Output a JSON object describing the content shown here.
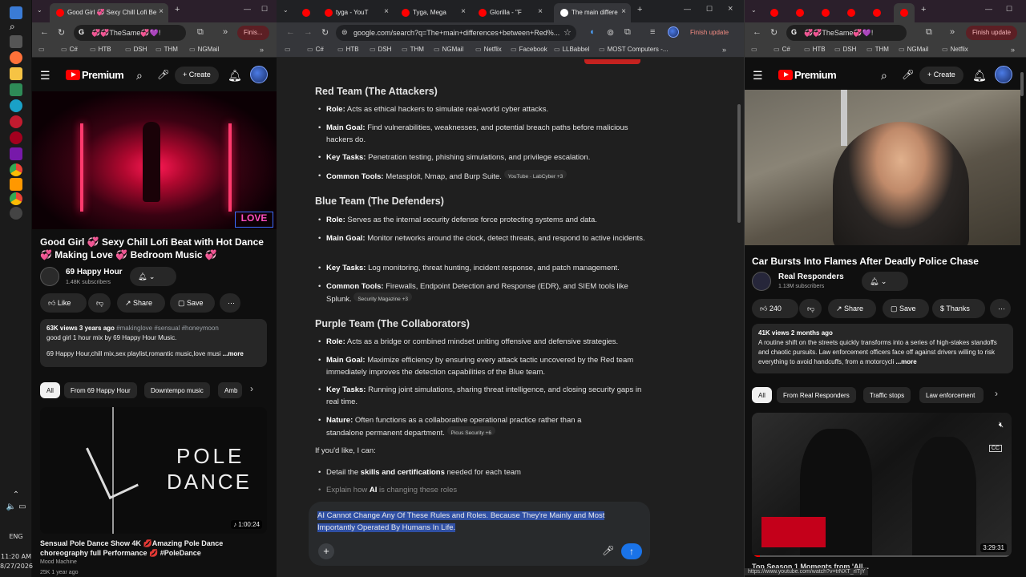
{
  "taskbar": {
    "time": "11:20 AM",
    "date": "8/27/2026",
    "lang": "ENG"
  },
  "left_window": {
    "tabs": [
      {
        "label": "Good Girl 💞 Sexy Chill Lofi Be"
      }
    ],
    "address": "💞💞TheSame💞💜!",
    "finish_label": "Finis...",
    "bookmarks": [
      "C#",
      "HTB",
      "DSH",
      "THM",
      "NGMail"
    ],
    "brand": "Premium",
    "create_label": "Create",
    "video_title": "Good Girl 💞 Sexy Chill Lofi Beat with Hot Dance 💞 Making Love 💞 Bedroom Music 💞",
    "channel_name": "69 Happy Hour",
    "subscribers": "1.48K subscribers",
    "actions": {
      "like": "Like",
      "share": "Share",
      "save": "Save"
    },
    "desc_stats": "63K views  3 years ago",
    "desc_tags": "#makinglove #sensual #honeymoon",
    "desc_line1": "good girl 1 hour mix by 69 Happy Hour Music.",
    "desc_line2": "69 Happy Hour,chill mix,sex playlist,romantic music,love musi",
    "desc_more": "...more",
    "chips": [
      "All",
      "From 69 Happy Hour",
      "Downtempo music",
      "Amb"
    ],
    "thumb_text_1": "POLE",
    "thumb_text_2": "DANCE",
    "thumb_duration": "1:00:24",
    "next_title": "Sensual Pole Dance Show 4K 💋Amazing Pole Dance choreography full Performance 💋 #PoleDance",
    "next_channel": "Mood Machine",
    "next_meta": "25K  1 year ago"
  },
  "middle_window": {
    "tabs": [
      {
        "label": ""
      },
      {
        "label": "tyga - YouT"
      },
      {
        "label": "Tyga, Mega"
      },
      {
        "label": "Glorilla - \"F"
      },
      {
        "label": "The main differe"
      }
    ],
    "url": "google.com/search?q=The+main+differences+between+Red%...",
    "finish_label": "Finish update",
    "bookmarks": [
      "C#",
      "HTB",
      "DSH",
      "THM",
      "NGMail",
      "Netflix",
      "Facebook",
      "LLBabbel",
      "MOST Computers -..."
    ],
    "sections": [
      {
        "heading": "Red Team (The Attackers)",
        "items": [
          {
            "label": "Role:",
            "text": "Acts as ethical hackers to simulate real-world cyber attacks.",
            "source": ""
          },
          {
            "label": "Main Goal:",
            "text": "Find vulnerabilities, weaknesses, and potential breach paths before malicious hackers do.",
            "source": ""
          },
          {
            "label": "Key Tasks:",
            "text": "Penetration testing, phishing simulations, and privilege escalation.",
            "source": ""
          },
          {
            "label": "Common Tools:",
            "text": "Metasploit, Nmap, and Burp Suite.",
            "source": "YouTube · LabCyber +3"
          }
        ]
      },
      {
        "heading": "Blue Team (The Defenders)",
        "items": [
          {
            "label": "Role:",
            "text": "Serves as the internal security defense force protecting systems and data.",
            "source": ""
          },
          {
            "label": "Main Goal:",
            "text": "Monitor networks around the clock, detect threats, and respond to active incidents.",
            "source": ""
          },
          {
            "label": "Key Tasks:",
            "text": "Log monitoring, threat hunting, incident response, and patch management.",
            "source": ""
          },
          {
            "label": "Common Tools:",
            "text": "Firewalls, Endpoint Detection and Response (EDR), and SIEM tools like Splunk.",
            "source": "Security Magazine +3"
          }
        ]
      },
      {
        "heading": "Purple Team (The Collaborators)",
        "items": [
          {
            "label": "Role:",
            "text": "Acts as a bridge or combined mindset uniting offensive and defensive strategies.",
            "source": ""
          },
          {
            "label": "Main Goal:",
            "text": "Maximize efficiency by ensuring every attack tactic uncovered by the Red team immediately improves the detection capabilities of the Blue team.",
            "source": ""
          },
          {
            "label": "Key Tasks:",
            "text": "Running joint simulations, sharing threat intelligence, and closing security gaps in real time.",
            "source": ""
          },
          {
            "label": "Nature:",
            "text": "Often functions as a collaborative operational practice rather than a standalone permanent department.",
            "source": "Picus Security +6"
          }
        ]
      }
    ],
    "followup_intro": "If you'd like, I can:",
    "followup_1_pre": "Detail the ",
    "followup_1_bold": "skills and certifications",
    "followup_1_post": " needed for each team",
    "followup_2_pre": "Explain how ",
    "followup_2_bold": "AI",
    "followup_2_post": " is changing these roles",
    "composer_text": "AI Cannot Change Any Of These Rules and Roles. Because They're Mainly and Most Importantly Operated By Humans In Life."
  },
  "right_window": {
    "address": "💞💞TheSame💞💜!",
    "finish_label": "Finish update",
    "bookmarks": [
      "C#",
      "HTB",
      "DSH",
      "THM",
      "NGMail",
      "Netflix"
    ],
    "brand": "Premium",
    "create_label": "Create",
    "video_title": "Car Bursts Into Flames After Deadly Police Chase",
    "channel_name": "Real Responders",
    "subscribers": "1.13M subscribers",
    "actions": {
      "likes": "240",
      "share": "Share",
      "save": "Save",
      "thanks": "Thanks"
    },
    "desc_stats": "41K views  2 months ago",
    "desc_text": "A routine shift on the streets quickly transforms into a series of high-stakes standoffs and chaotic pursuits. Law enforcement officers face off against drivers willing to risk everything to avoid handcuffs, from a motorcycli",
    "desc_more": "...more",
    "chips": [
      "All",
      "From Real Responders",
      "Traffic stops",
      "Law enforcement"
    ],
    "thumb_duration": "3:29:31",
    "next_title": "Top Season 1 Moments from 'All...",
    "status_url": "https://www.youtube.com/watch?v=trNXT_rITjY"
  },
  "colors": {
    "yt_red": "#ff0000",
    "accent_blue": "#2f4fa3",
    "send_blue": "#1a73e8"
  }
}
